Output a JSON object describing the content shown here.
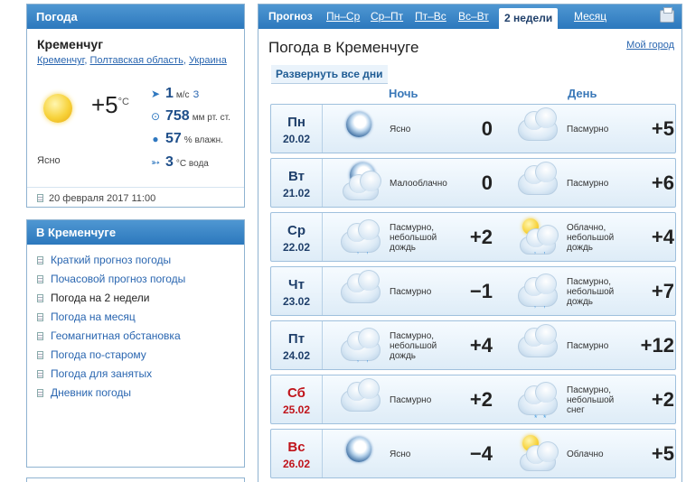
{
  "now": {
    "header": "Погода",
    "city": "Кременчуг",
    "path": [
      "Кременчуг",
      "Полтавская область",
      "Украина"
    ],
    "temp": "+5",
    "temp_unit": "°C",
    "condition": "Ясно",
    "wind_value": "1",
    "wind_unit": "м/с",
    "wind_dir": "З",
    "pressure_value": "758",
    "pressure_unit": "мм рт. ст.",
    "humidity_value": "57",
    "humidity_unit": "% влажн.",
    "water_value": "3",
    "water_unit": "°С вода",
    "updated": "20 февраля 2017 11:00",
    "icons": {
      "sun": "sun-icon",
      "wind": "wind-icon",
      "pressure": "pressure-icon",
      "humidity": "drop-icon",
      "water": "water-icon"
    }
  },
  "menu": {
    "header": "В Кременчуге",
    "items": [
      {
        "label": "Краткий прогноз погоды",
        "current": false
      },
      {
        "label": "Почасовой прогноз погоды",
        "current": false
      },
      {
        "label": "Погода на 2 недели",
        "current": true
      },
      {
        "label": "Погода на месяц",
        "current": false
      },
      {
        "label": "Геомагнитная обстановка",
        "current": false
      },
      {
        "label": "Погода по-старому",
        "current": false
      },
      {
        "label": "Погода для занятых",
        "current": false
      },
      {
        "label": "Дневник погоды",
        "current": false
      }
    ]
  },
  "forecast": {
    "tabs": [
      "Прогноз",
      "Пн–Ср",
      "Ср–Пт",
      "Пт–Вс",
      "Вс–Вт",
      "2 недели",
      "Месяц"
    ],
    "active_tab": "2 недели",
    "title": "Погода в Кременчуге",
    "my_city": "Мой город",
    "expand": "Развернуть все дни",
    "night_label": "Ночь",
    "day_label": "День",
    "days": [
      {
        "name": "Пн",
        "date": "20.02",
        "weekend": false,
        "night_icon": "moon",
        "night_cond": "Ясно",
        "night_temp": "0",
        "day_icon": "cloud",
        "day_cond": "Пасмурно",
        "day_temp": "+5"
      },
      {
        "name": "Вт",
        "date": "21.02",
        "weekend": false,
        "night_icon": "moon-cloud",
        "night_cond": "Малооблачно",
        "night_temp": "0",
        "day_icon": "cloud",
        "day_cond": "Пасмурно",
        "day_temp": "+6"
      },
      {
        "name": "Ср",
        "date": "22.02",
        "weekend": false,
        "night_icon": "cloud-rain",
        "night_cond": "Пасмурно, небольшой дождь",
        "night_temp": "+2",
        "day_icon": "sun-cloud-rain",
        "day_cond": "Облачно, небольшой дождь",
        "day_temp": "+4"
      },
      {
        "name": "Чт",
        "date": "23.02",
        "weekend": false,
        "night_icon": "cloud",
        "night_cond": "Пасмурно",
        "night_temp": "−1",
        "day_icon": "cloud-rain",
        "day_cond": "Пасмурно, небольшой дождь",
        "day_temp": "+7"
      },
      {
        "name": "Пт",
        "date": "24.02",
        "weekend": false,
        "night_icon": "cloud-rain",
        "night_cond": "Пасмурно, небольшой дождь",
        "night_temp": "+4",
        "day_icon": "cloud",
        "day_cond": "Пасмурно",
        "day_temp": "+12"
      },
      {
        "name": "Сб",
        "date": "25.02",
        "weekend": true,
        "night_icon": "cloud",
        "night_cond": "Пасмурно",
        "night_temp": "+2",
        "day_icon": "cloud-snow",
        "day_cond": "Пасмурно, небольшой снег",
        "day_temp": "+2"
      },
      {
        "name": "Вс",
        "date": "26.02",
        "weekend": true,
        "night_icon": "moon",
        "night_cond": "Ясно",
        "night_temp": "−4",
        "day_icon": "sun-cloud",
        "day_cond": "Облачно",
        "day_temp": "+5"
      }
    ]
  }
}
